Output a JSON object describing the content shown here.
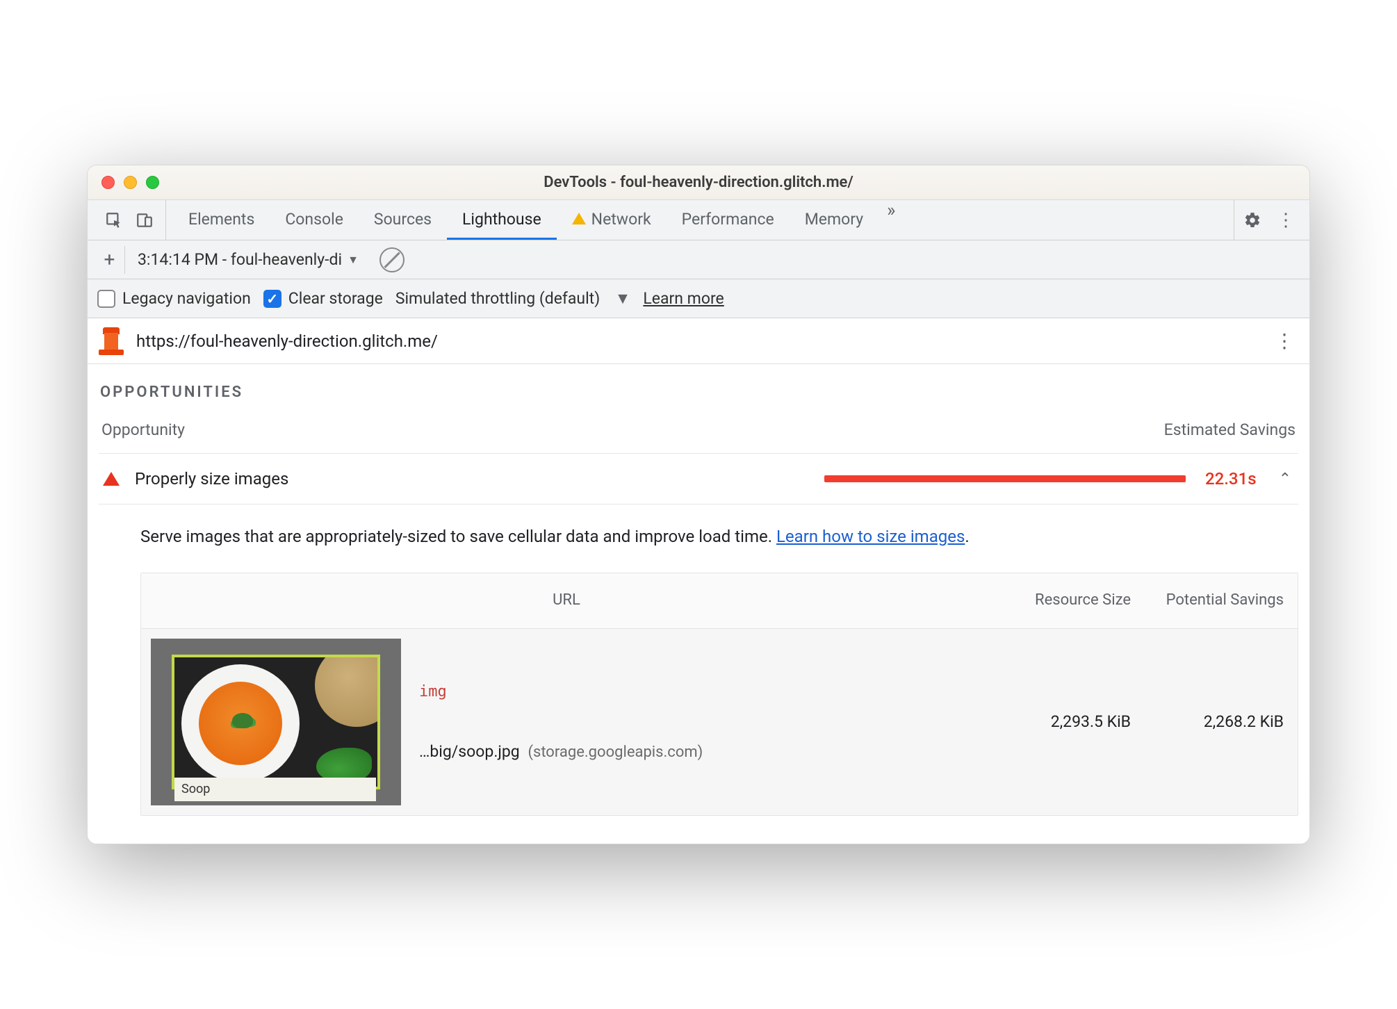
{
  "window": {
    "title": "DevTools - foul-heavenly-direction.glitch.me/"
  },
  "tabs": {
    "items": [
      "Elements",
      "Console",
      "Sources",
      "Lighthouse",
      "Network",
      "Performance",
      "Memory"
    ],
    "active": "Lighthouse",
    "warn_tab": "Network"
  },
  "subbar": {
    "run_label": "3:14:14 PM - foul-heavenly-di"
  },
  "options": {
    "legacy_label": "Legacy navigation",
    "clear_label": "Clear storage",
    "throttle_label": "Simulated throttling (default)",
    "learn_more": "Learn more"
  },
  "urlbar": {
    "url": "https://foul-heavenly-direction.glitch.me/"
  },
  "section": {
    "heading": "OPPORTUNITIES",
    "col_opportunity": "Opportunity",
    "col_savings": "Estimated Savings"
  },
  "audit": {
    "title": "Properly size images",
    "time": "22.31s",
    "desc_pre": "Serve images that are appropriately-sized to save cellular data and improve load time. ",
    "desc_link": "Learn how to size images",
    "desc_post": "."
  },
  "table": {
    "head_url": "URL",
    "head_size": "Resource Size",
    "head_savings": "Potential Savings",
    "row": {
      "tag": "img",
      "caption": "Soop",
      "path": "…big/soop.jpg",
      "host": "(storage.googleapis.com)",
      "size": "2,293.5 KiB",
      "savings": "2,268.2 KiB"
    }
  }
}
